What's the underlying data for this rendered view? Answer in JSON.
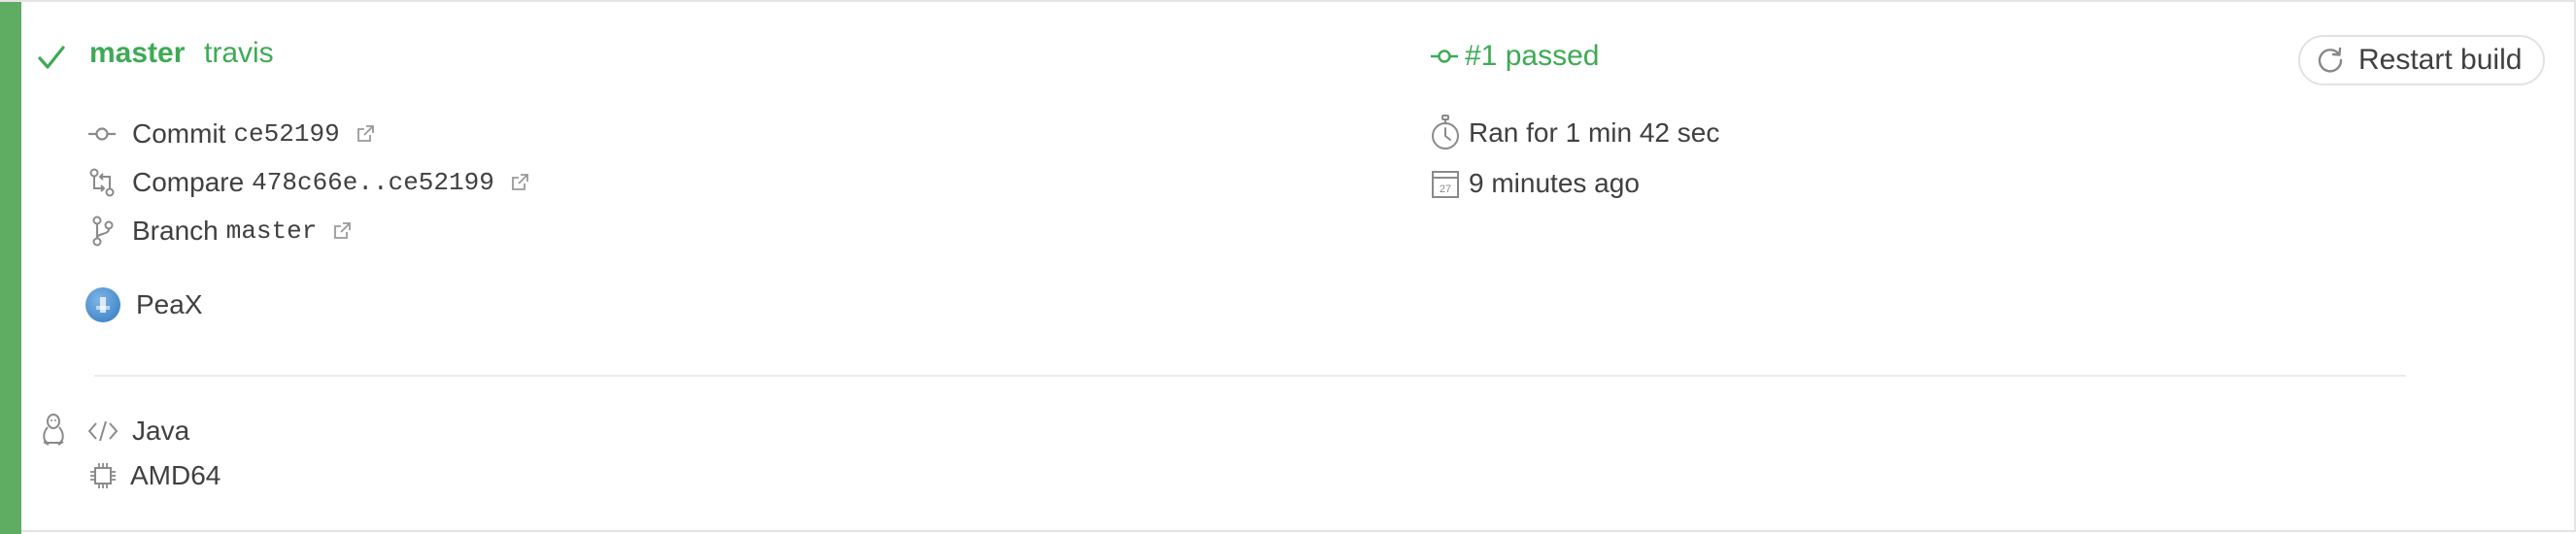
{
  "colors": {
    "status": "#5fad63",
    "passed_text": "#3eaa55"
  },
  "build": {
    "branch_name": "master",
    "commit_message": "travis",
    "build_number_status": "#1 passed",
    "restart_label": "Restart build"
  },
  "commit": {
    "label": "Commit",
    "sha": "ce52199"
  },
  "compare": {
    "label": "Compare",
    "range": "478c66e..ce52199"
  },
  "branch": {
    "label": "Branch",
    "name": "master"
  },
  "author": {
    "name": "PeaX"
  },
  "duration": {
    "text": "Ran for 1 min 42 sec"
  },
  "finished": {
    "text": "9 minutes ago",
    "calendar_day": "27"
  },
  "job": {
    "language": "Java",
    "arch": "AMD64"
  },
  "icons": [
    "check-icon",
    "commit-icon",
    "external-link-icon",
    "compare-icon",
    "branch-icon",
    "stopwatch-icon",
    "calendar-icon",
    "restart-icon",
    "linux-icon",
    "code-icon",
    "cpu-icon"
  ]
}
